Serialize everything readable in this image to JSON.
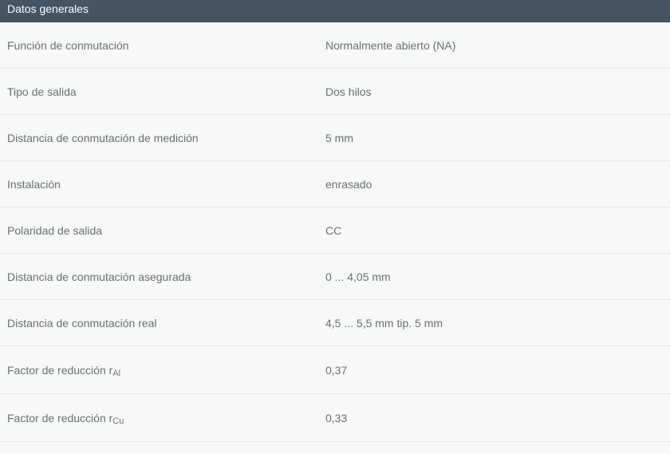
{
  "section": {
    "title": "Datos generales"
  },
  "rows": [
    {
      "label": "Función de conmutación",
      "value": "Normalmente abierto (NA)"
    },
    {
      "label": "Tipo de salida",
      "value": "Dos hilos"
    },
    {
      "label": "Distancia de conmutación de medición",
      "value": "5 mm"
    },
    {
      "label": "Instalación",
      "value": "enrasado"
    },
    {
      "label": "Polaridad de salida",
      "value": "CC"
    },
    {
      "label": "Distancia de conmutación asegurada",
      "value": "0 ... 4,05 mm"
    },
    {
      "label": "Distancia de conmutación real",
      "value": "4,5 ... 5,5 mm tip. 5 mm"
    },
    {
      "label": "Factor de reducción r",
      "label_sub": "Al",
      "value": "0,37"
    },
    {
      "label": "Factor de reducción r",
      "label_sub": "Cu",
      "value": "0,33"
    }
  ],
  "colors": {
    "header_bg": "#445461",
    "header_text": "#ffffff",
    "body_bg": "#f7f8f8",
    "text": "#6b6f72",
    "divider": "#e4e6e7"
  }
}
